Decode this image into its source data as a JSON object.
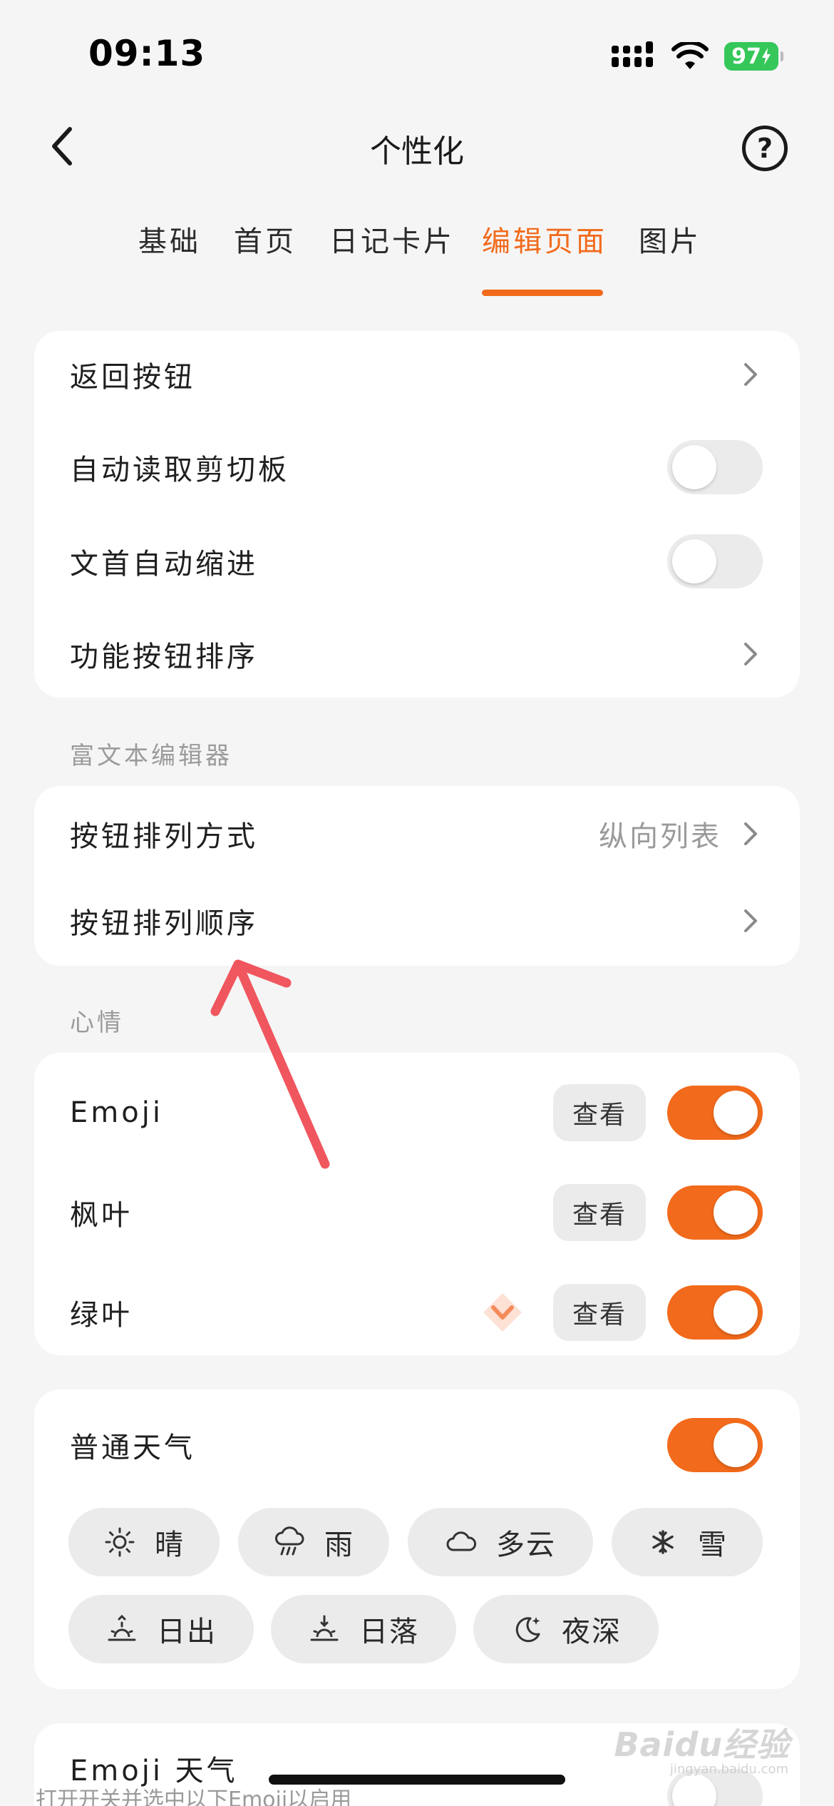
{
  "status_bar": {
    "time": "09:13",
    "battery": "97"
  },
  "header": {
    "title": "个性化",
    "help": "?"
  },
  "tabs": [
    {
      "label": "基础",
      "active": false
    },
    {
      "label": "首页",
      "active": false
    },
    {
      "label": "日记卡片",
      "active": false
    },
    {
      "label": "编辑页面",
      "active": true
    },
    {
      "label": "图片",
      "active": false
    }
  ],
  "general": {
    "back_button": "返回按钮",
    "auto_clipboard": "自动读取剪切板",
    "auto_indent": "文首自动缩进",
    "function_order": "功能按钮排序"
  },
  "rich_editor": {
    "section": "富文本编辑器",
    "layout_label": "按钮排列方式",
    "layout_value": "纵向列表",
    "order_label": "按钮排列顺序"
  },
  "mood": {
    "section": "心情",
    "view_label": "查看",
    "items": [
      {
        "label": "Emoji",
        "enabled": true
      },
      {
        "label": "枫叶",
        "enabled": true
      },
      {
        "label": "绿叶",
        "enabled": true,
        "premium": true
      }
    ]
  },
  "weather": {
    "label": "普通天气",
    "enabled": true,
    "chips": [
      {
        "label": "晴",
        "icon": "sun-icon"
      },
      {
        "label": "雨",
        "icon": "rain-icon"
      },
      {
        "label": "多云",
        "icon": "cloud-icon"
      },
      {
        "label": "雪",
        "icon": "snowflake-icon"
      },
      {
        "label": "日出",
        "icon": "sunrise-icon"
      },
      {
        "label": "日落",
        "icon": "sunset-icon"
      },
      {
        "label": "夜深",
        "icon": "moon-icon"
      }
    ]
  },
  "emoji_weather": {
    "label": "Emoji 天气",
    "subtext": "打开开关并选中以下Emoji以启用"
  },
  "watermark": {
    "brand": "Baidu经验",
    "site": "jingyan.baidu.com"
  },
  "colors": {
    "accent": "#f26a1b",
    "background": "#f5f5f5",
    "card": "#ffffff"
  }
}
